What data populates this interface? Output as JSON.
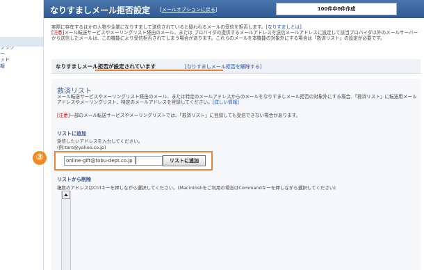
{
  "sidebar": {
    "items": [
      {
        "label": "ブック"
      },
      {
        "label": "ー"
      },
      {
        "label": "ッド"
      },
      {
        "label": "報"
      }
    ]
  },
  "header": {
    "title": "なりすましメール拒否設定",
    "back_prefix": "[",
    "back_link": "メールオプションに戻る",
    "back_suffix": "]",
    "count": "100件中0件作成"
  },
  "intro": {
    "line1": "実際に存在するほかの人物や企業になりすまして送信されていると疑われるメールの受信を拒否します。",
    "line1_link": "[なりすましとは]",
    "note_label": "[注意]",
    "note_text": "メール転送サービスやメーリングリスト経由のメール、または プロバイダの提供するメールアドレスを送信メールアドレスに設定して該当プロバイダ以外のメールサーバーから送信したメールは、この機能により受信拒否されてしまう場合があります。これらのメールを本機能の対象外にする場合は「救済リスト」の設定が必要です。"
  },
  "status": {
    "text": "なりすましメール拒否が設定されています",
    "link": "[なりすましメール拒否を解除する]"
  },
  "rescue": {
    "title": "救済リスト",
    "desc": "メール転送サービスやメーリングリスト経由のメール、または特定のメールアドレスからのメールをなりすましメール拒否の対象外にする場合、「救済リスト」に転送用メールアドレスやメーリングリスト、特定のメールアドレスを登録してください。",
    "desc_link": "[詳しい情報]",
    "note_label": "[注意]",
    "note_text": "一部のメール転送サービスやメーリングリストでは、「救済リスト」に登録しても受信できない場合があります。"
  },
  "add": {
    "title": "リストに追加",
    "desc": "受信したいアドレスを入力してください。",
    "example": "(例:taro@yahoo.co.jp)",
    "input_value": "online-gift@tobu-dept.co.jp",
    "button": "リストに追加",
    "step_marker": "③"
  },
  "remove": {
    "title": "リストから削除",
    "desc": "複数のアドレスはCtrlキーを押しながら選択してください。(Macintoshをご利用の場合はCommandキーを押しながら選択してください)"
  }
}
